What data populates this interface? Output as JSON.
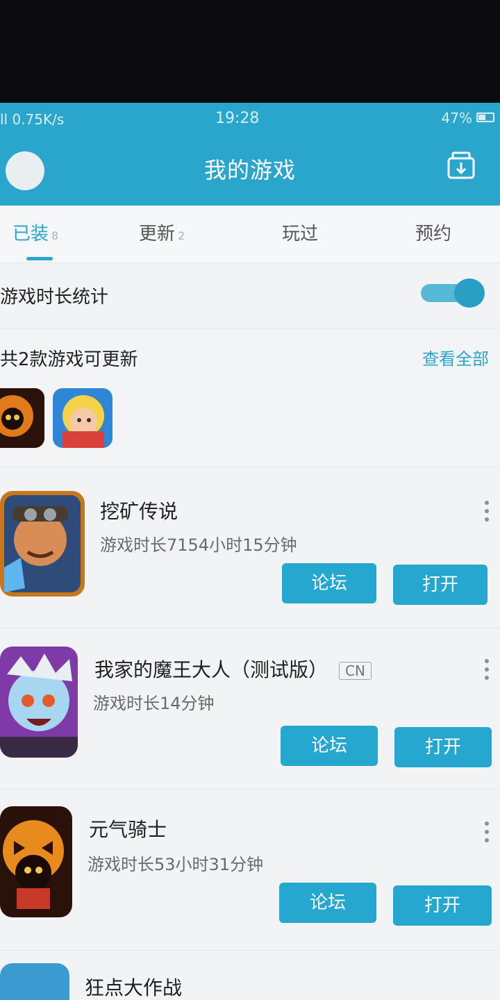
{
  "status_bar": {
    "network": "ll 0.75K/s",
    "time": "19:28",
    "battery": "47%"
  },
  "header": {
    "title": "我的游戏"
  },
  "tabs": [
    {
      "label": "已装",
      "count": "8"
    },
    {
      "label": "更新",
      "count": "2"
    },
    {
      "label": "玩过",
      "count": ""
    },
    {
      "label": "预约",
      "count": ""
    }
  ],
  "stats": {
    "label": "游戏时长统计",
    "enabled": true
  },
  "updates": {
    "label": "共2款游戏可更新",
    "view_all": "查看全部"
  },
  "games": [
    {
      "name": "挖矿传说",
      "tag": "",
      "duration": "游戏时长7154小时15分钟",
      "forum": "论坛",
      "open": "打开"
    },
    {
      "name": "我家的魔王大人（测试版）",
      "tag": "CN",
      "duration": "游戏时长14分钟",
      "forum": "论坛",
      "open": "打开"
    },
    {
      "name": "元气骑士",
      "tag": "",
      "duration": "游戏时长53小时31分钟",
      "forum": "论坛",
      "open": "打开"
    },
    {
      "name": "狂点大作战",
      "tag": "",
      "duration": "",
      "forum": "",
      "open": ""
    }
  ],
  "colors": {
    "accent": "#2aa6cc",
    "button": "#26a7cf",
    "background": "#eef1f2"
  }
}
